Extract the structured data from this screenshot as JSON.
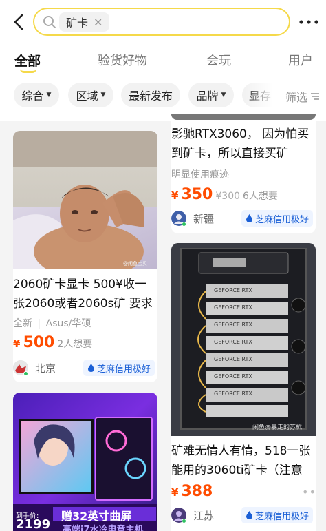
{
  "search": {
    "query_chip": "矿卡",
    "clear_icon": "close-icon"
  },
  "tabs": [
    "全部",
    "验货好物",
    "会玩",
    "用户"
  ],
  "filters": [
    "综合",
    "区域",
    "最新发布",
    "品牌",
    "显存",
    "筛选"
  ],
  "left_col": {
    "card1": {
      "title_line1": "2060矿卡显卡 500¥收一",
      "title_line2": "张2060或者2060s矿 要求",
      "condition": "全新",
      "brand": "Asus/华硕",
      "price_symbol": "¥",
      "price": "500",
      "want": "2人想要",
      "location": "北京",
      "credit": "芝麻信用极好",
      "watermark": "@闲鱼宝贝"
    },
    "card2": {
      "promo_tag": "到手价:",
      "promo_price": "2199",
      "promo_main": "赠32英寸曲屏",
      "promo_sub": "高端i7水冷电竞主机"
    }
  },
  "right_col": {
    "card1": {
      "title_line1": "影驰RTX3060， 因为怕买",
      "title_line2": "到矿卡，所以直接买矿",
      "subtitle": "明显使用痕迹",
      "price_symbol": "¥",
      "price": "350",
      "orig_price": "¥300",
      "want": "6人想要",
      "location": "新疆",
      "credit": "芝麻信用极好"
    },
    "card2": {
      "gpu_label": "GEFORCE RTX",
      "watermark": "闲鱼@暴走的苏杭",
      "title_line1": "矿难无情人有情，518一张",
      "title_line2": "能用的3060ti矿卡（注意",
      "price_symbol": "¥",
      "price": "388",
      "location": "江苏",
      "credit": "芝麻信用极好"
    }
  },
  "colors": {
    "accent": "#f5d94a",
    "price": "#ff4c00",
    "credit": "#1a5fd6"
  }
}
